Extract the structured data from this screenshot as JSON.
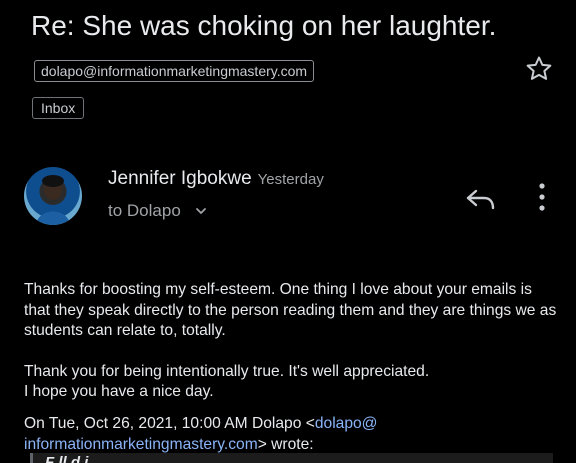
{
  "message": {
    "subject": "Re: She was choking on her laughter.",
    "sender_email_chip": "dolapo@informationmarketingmastery.com",
    "label": "Inbox",
    "sender_name": "Jennifer Igbokwe",
    "time": "Yesterday",
    "to_line": "to Dolapo",
    "body": {
      "paragraph1": "Thanks for boosting my self-esteem. One thing I love about your emails is that they speak directly to the person reading them and they are things we as students can relate to, totally.",
      "paragraph2_line1": "Thank you for being intentionally true. It's well appreciated.",
      "paragraph2_line2": "I hope you have a nice day."
    },
    "quote": {
      "prefix": "On Tue, Oct 26, 2021, 10:00 AM Dolapo <",
      "link_part1": "dolapo@",
      "link_part2": "informationmarketingmastery.com",
      "suffix": "> wrote:",
      "snippet": "F ll d    i"
    }
  },
  "icons": {
    "star": "star-outline-icon",
    "reply": "reply-icon",
    "more": "more-vert-icon",
    "expand": "chevron-down-icon"
  },
  "colors": {
    "background": "#000000",
    "text": "#e8eaed",
    "secondary_text": "#a0a3a7",
    "link": "#8ab4f8"
  }
}
